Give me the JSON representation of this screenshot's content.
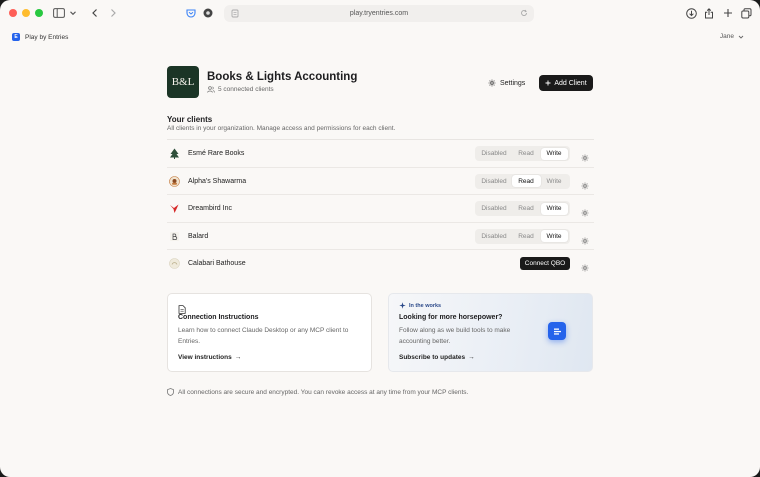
{
  "browser": {
    "url": "play.tryentries.com"
  },
  "app": {
    "brand_label": "Play by Entries",
    "brand_initial": "E",
    "user_name": "Jane"
  },
  "org": {
    "logo_text": "B&L",
    "name": "Books & Lights Accounting",
    "connected_count": "5 connected clients",
    "settings_label": "Settings",
    "add_client_label": "Add Client"
  },
  "clients_section": {
    "title": "Your clients",
    "subtitle": "All clients in your organization. Manage access and permissions for each client."
  },
  "clients": [
    {
      "name": "Esmé Rare Books",
      "options": [
        "Disabled",
        "Read",
        "Write"
      ],
      "selected": "Write",
      "logo": "tree-logo",
      "logo_color": "#2f4f3a"
    },
    {
      "name": "Alpha's Shawarma",
      "options": [
        "Disabled",
        "Read",
        "Write"
      ],
      "selected": "Read",
      "logo": "round-logo",
      "logo_color": "#c47a3d"
    },
    {
      "name": "Dreambird Inc",
      "options": [
        "Disabled",
        "Read",
        "Write"
      ],
      "selected": "Write",
      "logo": "bird-logo",
      "logo_color": "#d62828"
    },
    {
      "name": "Balard",
      "options": [
        "Disabled",
        "Read",
        "Write"
      ],
      "selected": "Write",
      "logo": "monogram-logo",
      "logo_color": "#444444"
    },
    {
      "name": "Calabari Bathouse",
      "action_label": "Connect QBO",
      "logo": "round-logo",
      "logo_color": "#d9d2bd"
    }
  ],
  "cards": {
    "instructions": {
      "title": "Connection Instructions",
      "description": "Learn how to connect Claude Desktop or any MCP client to Entries.",
      "link": "View instructions",
      "arrow": "→"
    },
    "works": {
      "badge": "In the works",
      "title": "Looking for more horsepower?",
      "description": "Follow along as we build tools to make accounting better.",
      "link": "Subscribe to updates",
      "arrow": "→"
    }
  },
  "footer": {
    "text": "All connections are secure and encrypted. You can revoke access at any time from your MCP clients."
  },
  "colors": {
    "accent": "#2563eb",
    "primary_button": "#1a1a1a",
    "org_logo_bg": "#1b3526",
    "page_bg": "#faf8f6"
  }
}
